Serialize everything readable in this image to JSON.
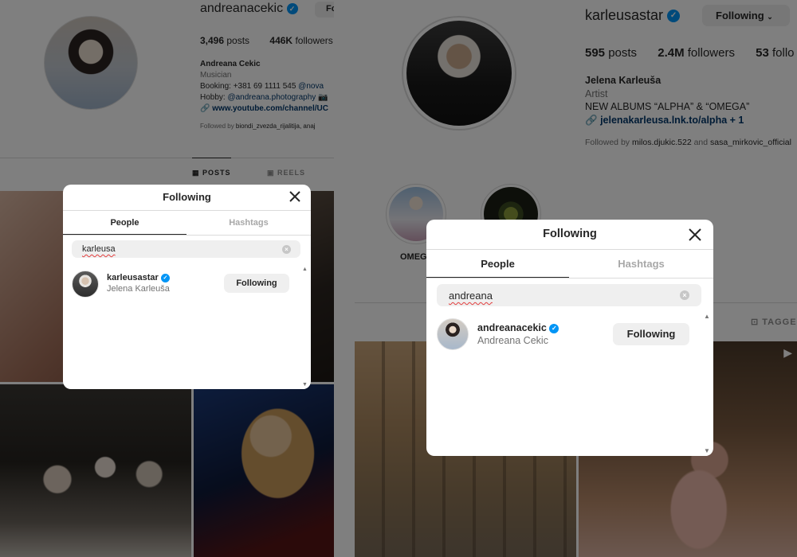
{
  "left": {
    "profile": {
      "username": "andreanacekic",
      "follow_btn": "Fo",
      "stats": {
        "posts": "3,496",
        "posts_label": "posts",
        "followers": "446K",
        "followers_label": "followers"
      },
      "bio": {
        "name": "Andreana Cekic",
        "category": "Musician",
        "line1_prefix": "Booking: +381 69 1111 545 ",
        "line1_link": "@nova",
        "line2_prefix": "Hobby: ",
        "line2_link": "@andreana.photography 📷",
        "link": "www.youtube.com/channel/UC"
      },
      "followed_by_prefix": "Followed by ",
      "followed_by_names": "biondi_zvezda_rijalitija, anaj"
    },
    "tabs": {
      "posts": "POSTS",
      "reels": "REELS"
    },
    "modal": {
      "title": "Following",
      "tab_people": "People",
      "tab_hashtags": "Hashtags",
      "search_value": "karleusa",
      "result": {
        "username": "karleusastar",
        "full_name": "Jelena Karleuša",
        "button": "Following"
      }
    }
  },
  "right": {
    "profile": {
      "username": "karleusastar",
      "follow_btn": "Following",
      "stats": {
        "posts": "595",
        "posts_label": "posts",
        "followers": "2.4M",
        "followers_label": "followers",
        "following": "53",
        "following_label": "follo"
      },
      "bio": {
        "name": "Jelena Karleuša",
        "category": "Artist",
        "text": "NEW ALBUMS “ALPHA” & “OMEGA”",
        "link": "jelenakarleusa.lnk.to/alpha + 1"
      },
      "followed_by_prefix": "Followed by ",
      "followed_by_a": "milos.djukic.522",
      "followed_by_and": " and ",
      "followed_by_b": "sasa_mirkovic_official"
    },
    "highlights": [
      {
        "label": "OMEGA"
      }
    ],
    "tabs": {
      "tagged": "TAGGE"
    },
    "modal": {
      "title": "Following",
      "tab_people": "People",
      "tab_hashtags": "Hashtags",
      "search_value": "andreana",
      "result": {
        "username": "andreanacekic",
        "full_name": "Andreana Cekic",
        "button": "Following"
      }
    }
  },
  "colors": {
    "verified": "#0095f6",
    "link": "#00376b",
    "overlay": "rgba(0,0,0,0.5)",
    "button_bg": "#efefef"
  }
}
